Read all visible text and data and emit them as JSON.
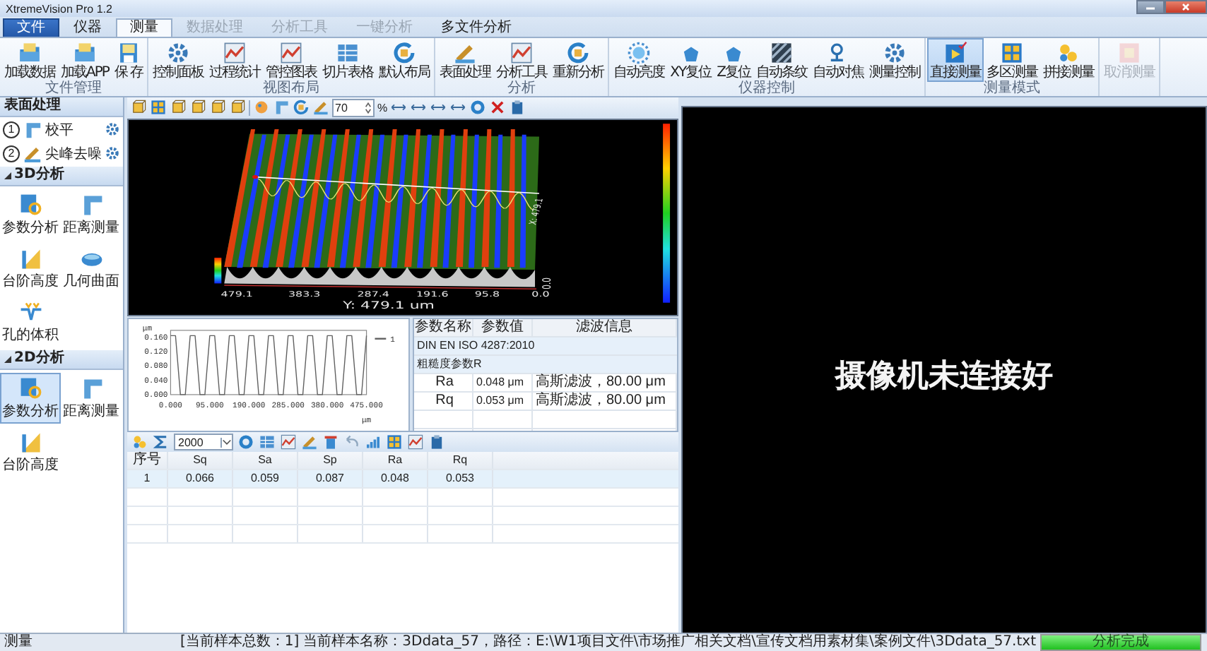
{
  "window": {
    "title": "XtremeVision Pro 1.2"
  },
  "tabs": [
    {
      "label": "文件",
      "kind": "file",
      "selected": false,
      "disabled": false
    },
    {
      "label": "仪器",
      "kind": "tab",
      "selected": false,
      "disabled": false
    },
    {
      "label": "测量",
      "kind": "tab",
      "selected": true,
      "disabled": false
    },
    {
      "label": "数据处理",
      "kind": "tab",
      "selected": false,
      "disabled": true
    },
    {
      "label": "分析工具",
      "kind": "tab",
      "selected": false,
      "disabled": true
    },
    {
      "label": "一键分析",
      "kind": "tab",
      "selected": false,
      "disabled": true
    },
    {
      "label": "多文件分析",
      "kind": "tab",
      "selected": false,
      "disabled": false
    }
  ],
  "ribbon": {
    "groups": [
      {
        "label": "文件管理",
        "buttons": [
          {
            "label": "加载数据",
            "selected": false,
            "disabled": false
          },
          {
            "label": "加载APP",
            "selected": false,
            "disabled": false
          },
          {
            "label": "保 存",
            "selected": false,
            "disabled": false
          }
        ]
      },
      {
        "label": "视图布局",
        "buttons": [
          {
            "label": "控制面板",
            "selected": false,
            "disabled": false
          },
          {
            "label": "过程统计",
            "selected": false,
            "disabled": false
          },
          {
            "label": "管控图表",
            "selected": false,
            "disabled": false
          },
          {
            "label": "切片表格",
            "selected": false,
            "disabled": false
          },
          {
            "label": "默认布局",
            "selected": false,
            "disabled": false
          }
        ]
      },
      {
        "label": "分析",
        "buttons": [
          {
            "label": "表面处理",
            "selected": false,
            "disabled": false
          },
          {
            "label": "分析工具",
            "selected": false,
            "disabled": false
          },
          {
            "label": "重新分析",
            "selected": false,
            "disabled": false
          }
        ]
      },
      {
        "label": "仪器控制",
        "buttons": [
          {
            "label": "自动亮度",
            "selected": false,
            "disabled": false
          },
          {
            "label": "XY复位",
            "selected": false,
            "disabled": false
          },
          {
            "label": "Z复位",
            "selected": false,
            "disabled": false
          },
          {
            "label": "自动条纹",
            "selected": false,
            "disabled": false
          },
          {
            "label": "自动对焦",
            "selected": false,
            "disabled": false
          },
          {
            "label": "测量控制",
            "selected": false,
            "disabled": false
          }
        ]
      },
      {
        "label": "测量模式",
        "buttons": [
          {
            "label": "直接测量",
            "selected": true,
            "disabled": false
          },
          {
            "label": "多区测量",
            "selected": false,
            "disabled": false
          },
          {
            "label": "拼接测量",
            "selected": false,
            "disabled": false
          }
        ]
      },
      {
        "buttons": [
          {
            "label": "取消测量",
            "selected": false,
            "disabled": true
          }
        ]
      }
    ]
  },
  "left_panel": {
    "sections": [
      {
        "title": "表面处理",
        "kind": "steps",
        "items": [
          {
            "step": "1",
            "label": "校平"
          },
          {
            "step": "2",
            "label": "尖峰去噪"
          }
        ]
      },
      {
        "title": "3D分析",
        "kind": "tools",
        "expanded": true,
        "items": [
          {
            "label": "参数分析",
            "selected": false
          },
          {
            "label": "距离测量",
            "selected": false
          },
          {
            "label": "台阶高度",
            "selected": false
          },
          {
            "label": "几何曲面",
            "selected": false
          },
          {
            "label": "孔的体积",
            "selected": false
          }
        ]
      },
      {
        "title": "2D分析",
        "kind": "tools",
        "expanded": true,
        "items": [
          {
            "label": "参数分析",
            "selected": true
          },
          {
            "label": "距离测量",
            "selected": false
          },
          {
            "label": "台阶高度",
            "selected": false
          }
        ]
      }
    ]
  },
  "view3d": {
    "zoom": "70",
    "zoom_unit": "%",
    "y_ticks": [
      "479.1",
      "383.3",
      "287.4",
      "191.6",
      "95.8",
      "0.0"
    ],
    "y_label": "Y: 479.1  um",
    "z_tick": "0.0",
    "x_label": "X: 479.1"
  },
  "profile": {
    "chart_data": {
      "type": "line",
      "ylabel": "μm",
      "xlabel": "μm",
      "x": [
        0,
        11.875,
        23.75,
        35.625,
        47.5,
        59.375,
        71.25,
        83.125,
        95,
        106.875,
        118.75,
        130.625,
        142.5,
        154.375,
        166.25,
        178.125,
        190,
        201.875,
        213.75,
        225.625,
        237.5,
        249.375,
        261.25,
        273.125,
        285,
        296.875,
        308.75,
        320.625,
        332.5,
        344.375,
        356.25,
        368.125,
        380,
        391.875,
        403.75,
        415.625,
        427.5,
        439.375,
        451.25,
        463.125,
        475
      ],
      "series": [
        {
          "name": "1",
          "color": "#606060",
          "values": [
            0.165,
            0.165,
            0.0,
            0.0,
            0.165,
            0.165,
            0.0,
            0.0,
            0.165,
            0.165,
            0.0,
            0.0,
            0.165,
            0.165,
            0.0,
            0.0,
            0.165,
            0.165,
            0.0,
            0.0,
            0.165,
            0.165,
            0.0,
            0.0,
            0.165,
            0.165,
            0.0,
            0.0,
            0.165,
            0.165,
            0.0,
            0.0,
            0.165,
            0.165,
            0.0,
            0.0,
            0.165,
            0.165,
            0.0,
            0.0,
            0.165
          ]
        }
      ],
      "xlim": [
        0,
        475
      ],
      "ylim": [
        0,
        0.18
      ],
      "xticks": [
        {
          "value": 0,
          "label": "0.000"
        },
        {
          "value": 95,
          "label": "95.000"
        },
        {
          "value": 190,
          "label": "190.000"
        },
        {
          "value": 285,
          "label": "285.000"
        },
        {
          "value": 380,
          "label": "380.000"
        },
        {
          "value": 475,
          "label": "475.000"
        }
      ],
      "yticks": [
        {
          "value": 0,
          "label": "0.000"
        },
        {
          "value": 0.04,
          "label": "0.040"
        },
        {
          "value": 0.08,
          "label": "0.080"
        },
        {
          "value": 0.12,
          "label": "0.120"
        },
        {
          "value": 0.16,
          "label": "0.160"
        }
      ]
    }
  },
  "params": {
    "columns": [
      "参数名称",
      "参数值",
      "滤波信息"
    ],
    "rows": [
      {
        "kind": "group",
        "name": "DIN EN ISO 4287:2010"
      },
      {
        "kind": "group",
        "name": "粗糙度参数R"
      },
      {
        "kind": "param",
        "name": "Ra",
        "value": "0.048 μm",
        "filter": "高斯滤波，80.00 μm"
      },
      {
        "kind": "param",
        "name": "Rq",
        "value": "0.053 μm",
        "filter": "高斯滤波，80.00 μm"
      }
    ]
  },
  "results": {
    "count_select": "2000",
    "columns": [
      "序号",
      "Sq",
      "Sa",
      "Sp",
      "Ra",
      "Rq"
    ],
    "rows": [
      [
        "1",
        "0.066",
        "0.059",
        "0.087",
        "0.048",
        "0.053"
      ]
    ]
  },
  "camera": {
    "message": "摄像机未连接好"
  },
  "status_bar": {
    "mode": "测量",
    "sample_count": "[当前样本总数：1]",
    "sample_info": "当前样本名称：3Ddata_57，路径：E:\\W1项目文件\\市场推广相关文档\\宣传文档用素材集\\案例文件\\3Ddata_57.txt",
    "progress": {
      "label": "分析完成",
      "level": 1
    }
  }
}
